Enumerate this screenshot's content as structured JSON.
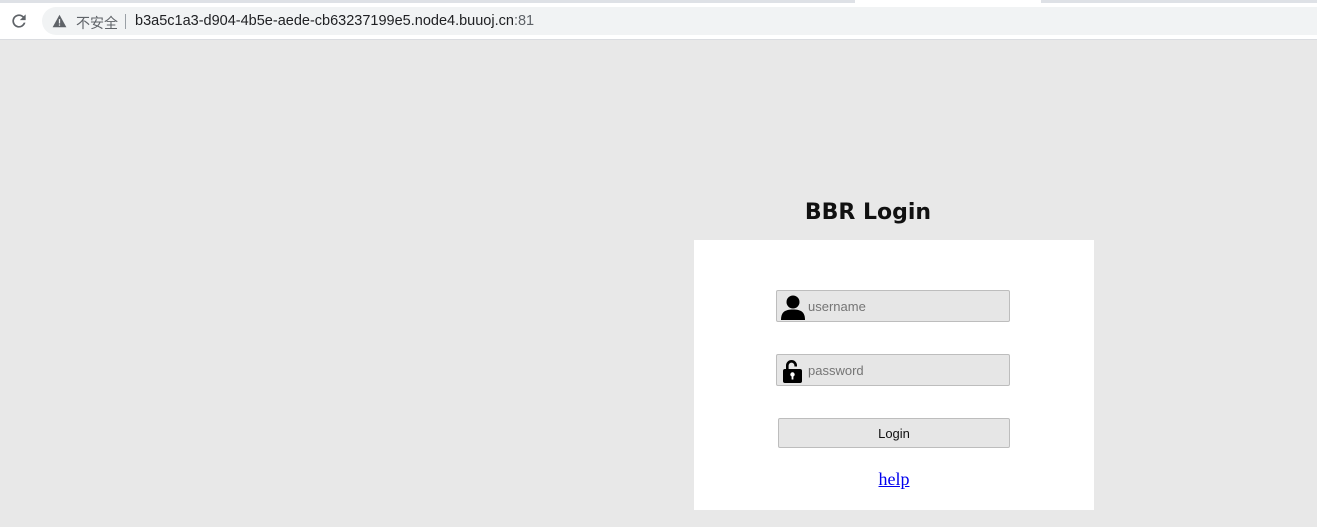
{
  "browser": {
    "security_label": "不安全",
    "url_host": "b3a5c1a3-d904-4b5e-aede-cb63237199e5.node4.buuoj.cn",
    "url_port": ":81"
  },
  "login": {
    "title": "BBR Login",
    "username_placeholder": "username",
    "password_placeholder": "password",
    "submit_label": "Login",
    "help_link": "help"
  },
  "colors": {
    "page_background": "#e8e8e8",
    "panel_background": "#ffffff",
    "field_background": "#e6e6e6",
    "link": "#0000ee"
  },
  "icons": {
    "reload": "reload-icon",
    "security": "warning-triangle-icon",
    "username": "user-icon",
    "password": "lock-icon"
  }
}
